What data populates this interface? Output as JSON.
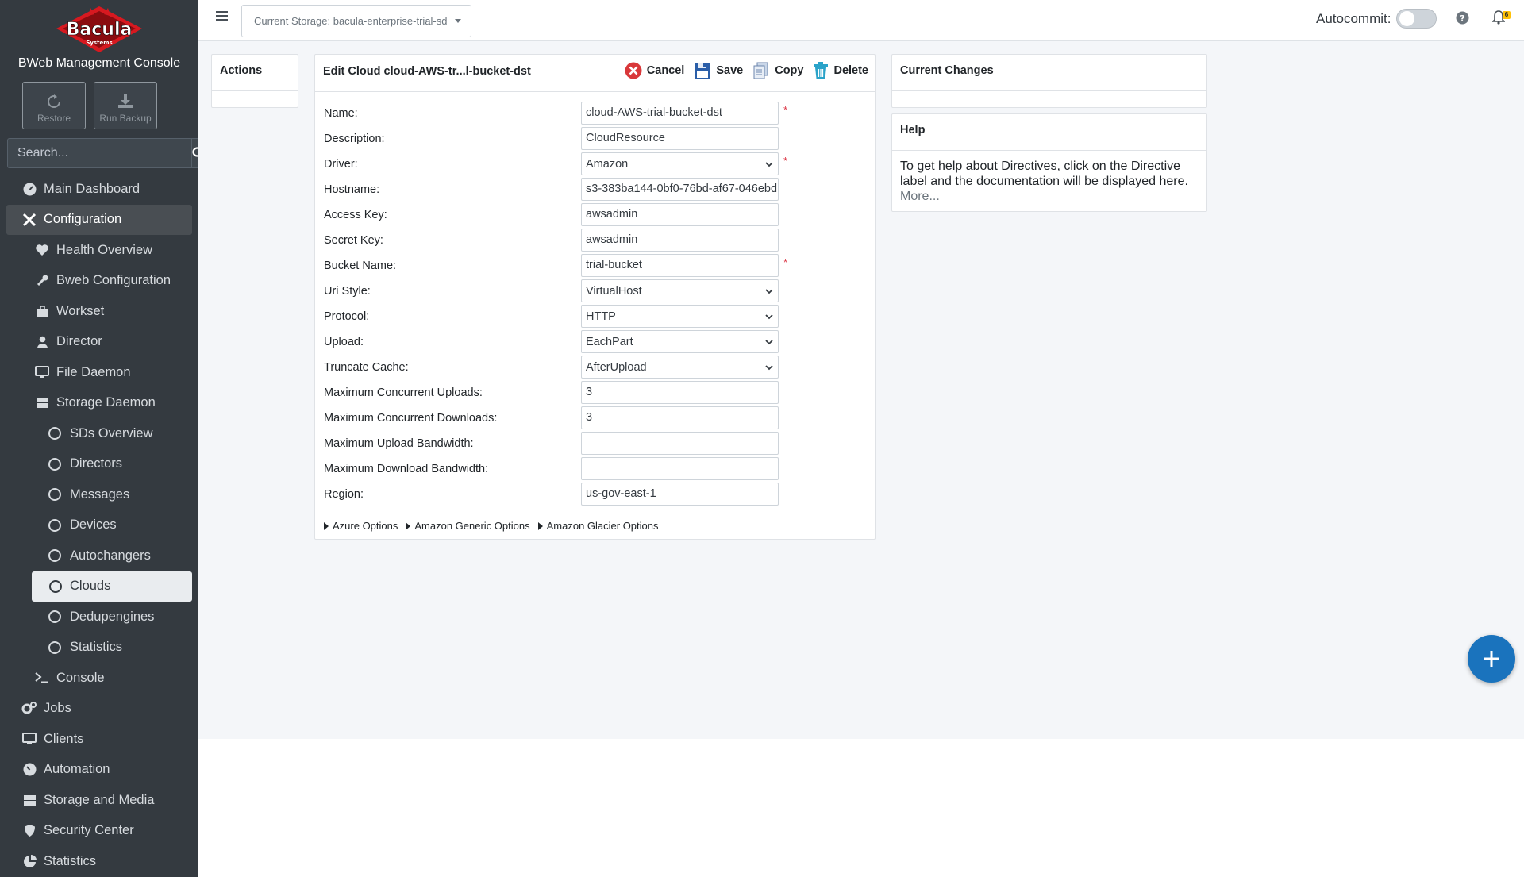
{
  "brand": {
    "logo_text": "Bacula",
    "logo_subtext": "Systems",
    "title": "BWeb Management Console",
    "colors": {
      "sidebar_bg": "#343a40",
      "logo_red": "#d71920",
      "fab_blue": "#1a73bd"
    }
  },
  "quick_actions": [
    {
      "label": "Restore",
      "icon": "restore-icon"
    },
    {
      "label": "Run Backup",
      "icon": "download-icon"
    }
  ],
  "search": {
    "placeholder": "Search..."
  },
  "nav": {
    "main_dashboard": "Main Dashboard",
    "configuration": "Configuration",
    "health_overview": "Health Overview",
    "bweb_configuration": "Bweb Configuration",
    "workset": "Workset",
    "director": "Director",
    "file_daemon": "File Daemon",
    "storage_daemon": "Storage Daemon",
    "sds_overview": "SDs Overview",
    "directors": "Directors",
    "messages": "Messages",
    "devices": "Devices",
    "autochangers": "Autochangers",
    "clouds": "Clouds",
    "dedupengines": "Dedupengines",
    "statistics_sub": "Statistics",
    "console": "Console",
    "jobs": "Jobs",
    "clients": "Clients",
    "automation": "Automation",
    "storage_and_media": "Storage and Media",
    "security_center": "Security Center",
    "statistics": "Statistics"
  },
  "topbar": {
    "current_storage": "Current Storage: bacula-enterprise-trial-sd",
    "autocommit_label": "Autocommit:",
    "autocommit_on": false,
    "notifications_count": "6"
  },
  "actions_card": {
    "title": "Actions"
  },
  "edit_card": {
    "title": "Edit Cloud cloud-AWS-tr...l-bucket-dst",
    "cancel": "Cancel",
    "save": "Save",
    "copy": "Copy",
    "delete": "Delete"
  },
  "form": {
    "name": {
      "label": "Name:",
      "value": "cloud-AWS-trial-bucket-dst",
      "required": "*"
    },
    "description": {
      "label": "Description:",
      "value": "CloudResource"
    },
    "driver": {
      "label": "Driver:",
      "value": "Amazon",
      "required": "*"
    },
    "hostname": {
      "label": "Hostname:",
      "value": "s3-383ba144-0bf0-76bd-af67-046ebd"
    },
    "access_key": {
      "label": "Access Key:",
      "value": "awsadmin"
    },
    "secret_key": {
      "label": "Secret Key:",
      "value": "awsadmin"
    },
    "bucket_name": {
      "label": "Bucket Name:",
      "value": "trial-bucket",
      "required": "*"
    },
    "uri_style": {
      "label": "Uri Style:",
      "value": "VirtualHost"
    },
    "protocol": {
      "label": "Protocol:",
      "value": "HTTP"
    },
    "upload": {
      "label": "Upload:",
      "value": "EachPart"
    },
    "truncate_cache": {
      "label": "Truncate Cache:",
      "value": "AfterUpload"
    },
    "max_concurrent_uploads": {
      "label": "Maximum Concurrent Uploads:",
      "value": "3"
    },
    "max_concurrent_downloads": {
      "label": "Maximum Concurrent Downloads:",
      "value": "3"
    },
    "max_upload_bandwidth": {
      "label": "Maximum Upload Bandwidth:",
      "value": ""
    },
    "max_download_bandwidth": {
      "label": "Maximum Download Bandwidth:",
      "value": ""
    },
    "region": {
      "label": "Region:",
      "value": "us-gov-east-1"
    }
  },
  "option_groups": {
    "azure": "Azure Options",
    "amazon_generic": "Amazon Generic Options",
    "amazon_glacier": "Amazon Glacier Options"
  },
  "changes_card": {
    "title": "Current Changes"
  },
  "help_card": {
    "title": "Help",
    "text": "To get help about Directives, click on the Directive label and the documentation will be displayed here.",
    "more": "More..."
  }
}
